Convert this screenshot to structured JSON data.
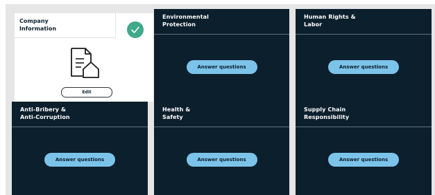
{
  "company_card": {
    "title": "Company\nInformation",
    "status": "completed",
    "edit_label": "Edit"
  },
  "cards": [
    {
      "title": "Environmental\nProtection",
      "button_label": "Answer questions"
    },
    {
      "title": "Human Rights &\nLabor",
      "button_label": "Answer questions"
    },
    {
      "title": "Anti-Bribery &\nAnti-Corruption",
      "button_label": "Answer questions"
    },
    {
      "title": "Health &\nSafety",
      "button_label": "Answer questions"
    },
    {
      "title": "Supply Chain\nResponsibility",
      "button_label": "Answer questions"
    }
  ],
  "colors": {
    "card_background": "#0c1f2c",
    "button_background": "#7cc3ea",
    "check_green": "#3fa98a",
    "board_background": "#e6e6e6"
  },
  "icons": {
    "status": "checkmark-icon",
    "company": "document-house-icon"
  }
}
